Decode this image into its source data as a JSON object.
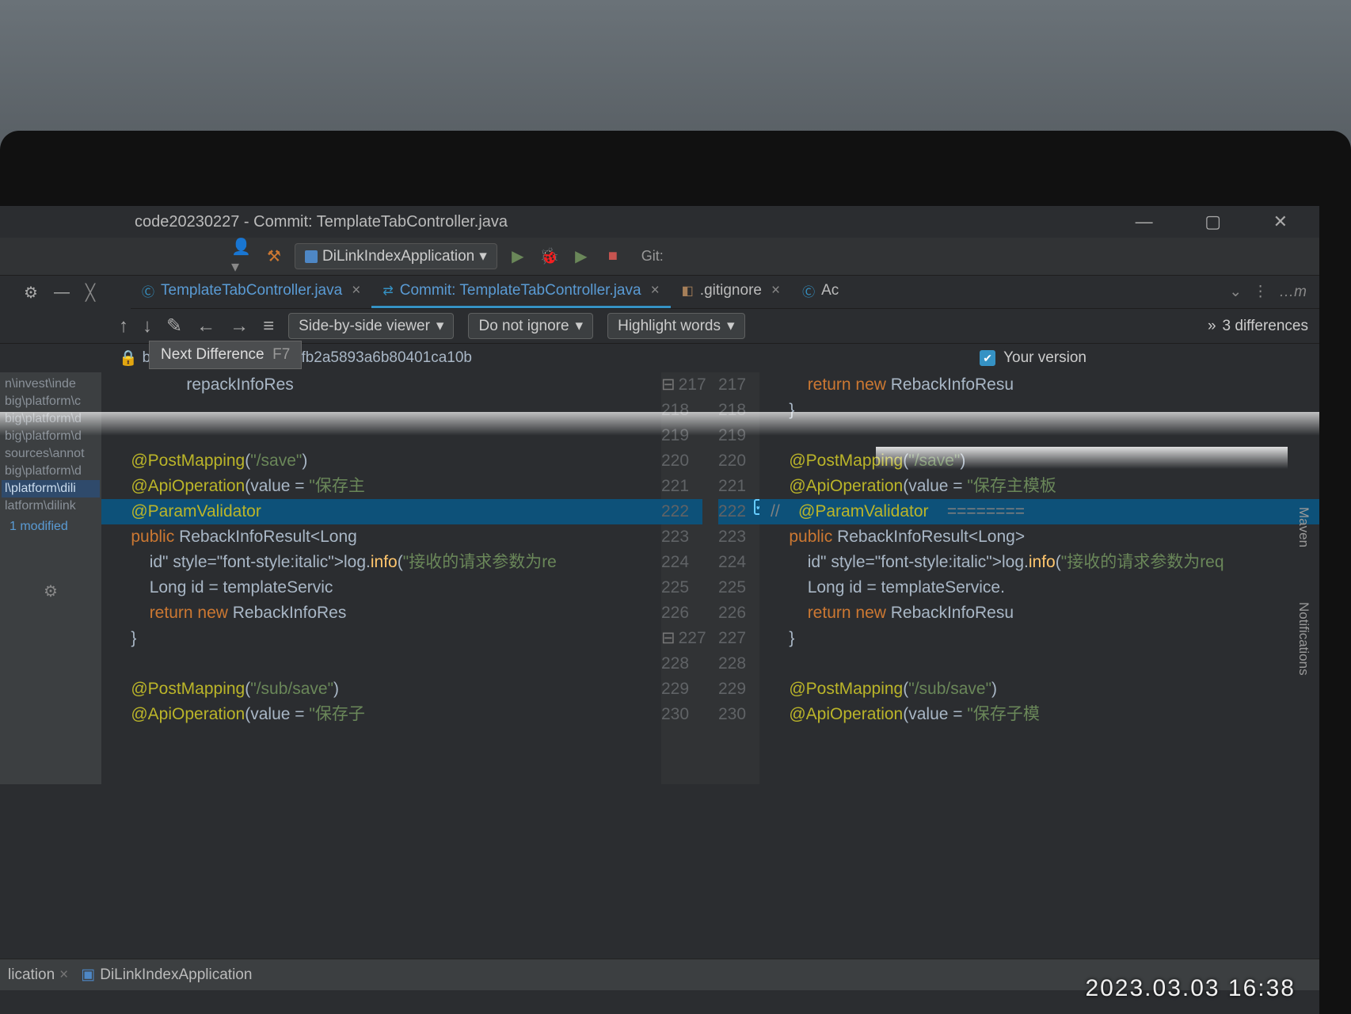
{
  "window": {
    "title": "code20230227 - Commit: TemplateTabController.java"
  },
  "runConfig": {
    "label": "DiLinkIndexApplication"
  },
  "git": {
    "label": "Git:"
  },
  "tabs": [
    {
      "label": "TemplateTabController.java",
      "type": "java"
    },
    {
      "label": "Commit: TemplateTabController.java",
      "type": "diff"
    },
    {
      "label": ".gitignore",
      "type": "git"
    },
    {
      "label": "Ac",
      "type": "java"
    }
  ],
  "diffToolbar": {
    "viewer": "Side-by-side viewer",
    "ignore": "Do not ignore",
    "highlight": "Highlight words",
    "diffCount": "3 differences"
  },
  "diffHeader": {
    "hash": "b176373d69e2d7ba0d3fb2a5893a6b80401ca10b",
    "rightLabel": "Your version"
  },
  "tooltip": {
    "label": "Next Difference",
    "shortcut": "F7"
  },
  "sidebar": {
    "items": [
      "n\\invest\\inde",
      "big\\platform\\c",
      "big\\platform\\d",
      "big\\platform\\d",
      "sources\\annot",
      "big\\platform\\d",
      "l\\platform\\dili",
      "latform\\dilink"
    ],
    "modifiedLabel": "1 modified"
  },
  "code": {
    "left": {
      "lines": [
        {
          "n": 217,
          "t": "                repackInfoRes",
          "fold": "⊟"
        },
        {
          "n": 218,
          "t": ""
        },
        {
          "n": 219,
          "t": ""
        },
        {
          "n": 220,
          "t": "    @PostMapping(\"/save\")"
        },
        {
          "n": 221,
          "t": "    @ApiOperation(value = \"保存主"
        },
        {
          "n": 222,
          "t": "    @ParamValidator",
          "hl": true,
          "chev": "»"
        },
        {
          "n": 223,
          "t": "    public RebackInfoResult<Long"
        },
        {
          "n": 224,
          "t": "        log.info(\"接收的请求参数为re"
        },
        {
          "n": 225,
          "t": "        Long id = templateServic"
        },
        {
          "n": 226,
          "t": "        return new RebackInfoRes"
        },
        {
          "n": 227,
          "t": "    }",
          "fold": "⊟"
        },
        {
          "n": 228,
          "t": ""
        },
        {
          "n": 229,
          "t": "    @PostMapping(\"/sub/save\")"
        },
        {
          "n": 230,
          "t": "    @ApiOperation(value = \"保存子"
        }
      ]
    },
    "right": {
      "lines": [
        {
          "n": 217,
          "t": "        return new RebackInfoResu",
          "fold": "⊟"
        },
        {
          "n": 218,
          "t": "    }"
        },
        {
          "n": 219,
          "t": ""
        },
        {
          "n": 220,
          "t": "    @PostMapping(\"/save\")"
        },
        {
          "n": 221,
          "t": "    @ApiOperation(value = \"保存主模板"
        },
        {
          "n": 222,
          "t": "//    @ParamValidator    ========",
          "hl": true,
          "check": true
        },
        {
          "n": 223,
          "t": "    public RebackInfoResult<Long>"
        },
        {
          "n": 224,
          "t": "        log.info(\"接收的请求参数为req"
        },
        {
          "n": 225,
          "t": "        Long id = templateService."
        },
        {
          "n": 226,
          "t": "        return new RebackInfoResu"
        },
        {
          "n": 227,
          "t": "    }",
          "fold": "⊟"
        },
        {
          "n": 228,
          "t": ""
        },
        {
          "n": 229,
          "t": "    @PostMapping(\"/sub/save\")"
        },
        {
          "n": 230,
          "t": "    @ApiOperation(value = \"保存子模"
        }
      ]
    }
  },
  "bottomTabs": [
    {
      "label": "lication"
    },
    {
      "label": "DiLinkIndexApplication"
    }
  ],
  "timestamp": "2023.03.03  16:38",
  "rightSidebar": {
    "maven": "Maven",
    "notifications": "Notifications"
  }
}
